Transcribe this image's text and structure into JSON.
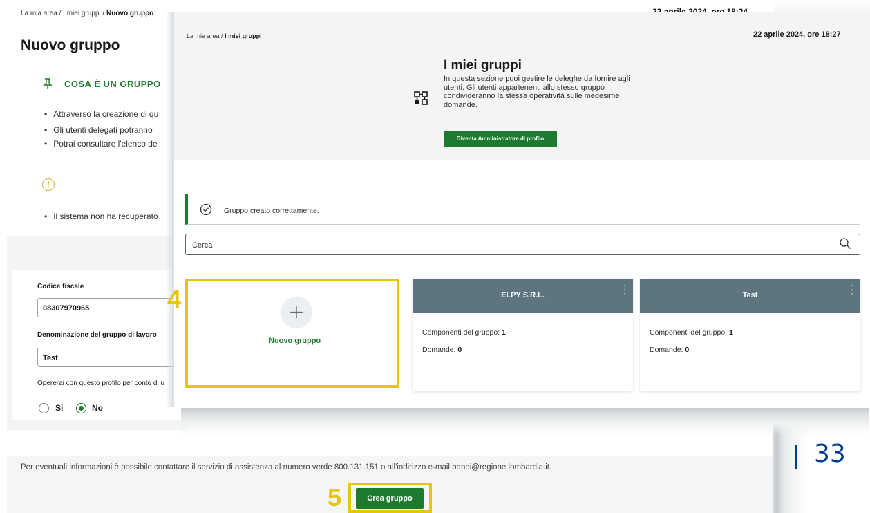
{
  "background_page": {
    "breadcrumb": [
      "La mia area",
      "I miei gruppi",
      "Nuovo gruppo"
    ],
    "date": "22 aprile 2024, ore 18:24",
    "title": "Nuovo gruppo",
    "info_heading": "COSA È UN GRUPPO",
    "info_items": [
      "Attraverso la creazione di qu",
      "Gli utenti delegati potranno",
      "Potrai consultare l'elenco de"
    ],
    "warning_items": [
      "Il sistema non ha recuperato"
    ],
    "fields": {
      "codice_fiscale_label": "Codice fiscale",
      "codice_fiscale_value": "08307970965",
      "denominazione_label": "Denominazione del gruppo di lavoro",
      "denominazione_value": "Test",
      "opererai_label": "Opererai con questo profilo per conto di u",
      "radio_si": "Si",
      "radio_no": "No",
      "radio_selected": "No"
    },
    "footer_text": "Per eventuali informazioni è possibile contattare il servizio di assistenza al numero verde 800.131.151 o all'indirizzo e-mail bandi@regione.lombardia.it.",
    "create_button": "Crea gruppo",
    "step_label": "5"
  },
  "front_page": {
    "breadcrumb": [
      "La mia area",
      "I miei gruppi"
    ],
    "date": "22 aprile 2024, ore 18:27",
    "title": "I miei gruppi",
    "description": "In questa sezione puoi gestire le deleghe da fornire agli utenti. Gli utenti appartenenti allo stesso gruppo condivideranno la stessa operatività sulle medesime domande.",
    "admin_button": "Diventa Amministratore di profilo",
    "alert_text": "Gruppo creato correttamente.",
    "search_placeholder": "Cerca",
    "new_group_link": "Nuovo gruppo",
    "step_label": "4",
    "groups": [
      {
        "name": "ELPY S.R.L.",
        "components_label": "Componenti del gruppo:",
        "components": "1",
        "domande_label": "Domande:",
        "domande": "0"
      },
      {
        "name": "Test",
        "components_label": "Componenti del gruppo:",
        "components": "1",
        "domande_label": "Domande:",
        "domande": "0"
      }
    ]
  },
  "slide_number": "33",
  "colors": {
    "accent_green": "#1e7a2f",
    "highlight_yellow": "#e6c60a",
    "card_header": "#5e7580",
    "slide_blue": "#003d8f"
  }
}
